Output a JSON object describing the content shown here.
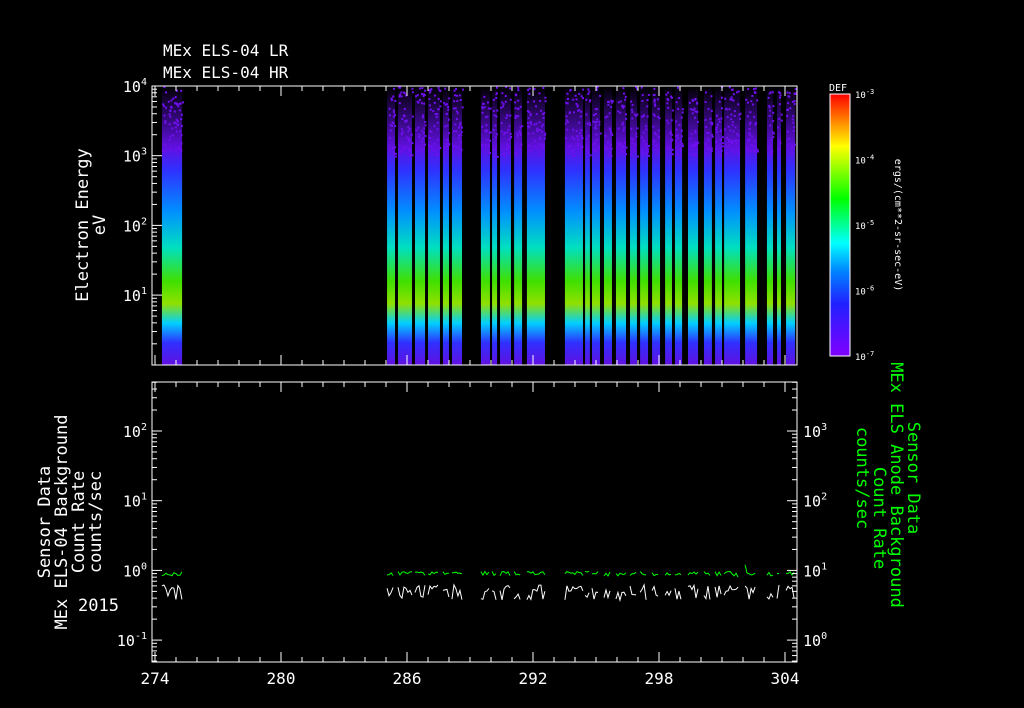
{
  "chart_data": [
    {
      "type": "heatmap",
      "title_lines": [
        "MEx ELS-04 LR",
        "MEx ELS-04 HR"
      ],
      "ylabel": [
        "Electron Energy",
        "eV"
      ],
      "ylim": [
        1,
        10000
      ],
      "yscale": "log",
      "yticks": [
        {
          "v": 10000,
          "b": "10",
          "e": "4"
        },
        {
          "v": 1000,
          "b": "10",
          "e": "3"
        },
        {
          "v": 100,
          "b": "10",
          "e": "2"
        },
        {
          "v": 10,
          "b": "10",
          "e": "1"
        }
      ],
      "xlim": [
        273.85,
        304.5
      ],
      "active_intervals_day": [
        [
          274.33,
          275.29
        ],
        [
          285.05,
          285.43
        ],
        [
          285.57,
          286.24
        ],
        [
          286.38,
          286.86
        ],
        [
          287.0,
          287.57
        ],
        [
          287.71,
          288.0
        ],
        [
          288.14,
          288.62
        ],
        [
          289.52,
          289.95
        ],
        [
          290.05,
          290.29
        ],
        [
          290.43,
          290.95
        ],
        [
          291.1,
          291.48
        ],
        [
          291.71,
          292.57
        ],
        [
          293.52,
          294.38
        ],
        [
          294.48,
          294.71
        ],
        [
          294.81,
          295.19
        ],
        [
          295.38,
          295.76
        ],
        [
          295.95,
          296.43
        ],
        [
          296.62,
          296.95
        ],
        [
          297.1,
          297.48
        ],
        [
          297.67,
          298.05
        ],
        [
          298.29,
          298.62
        ],
        [
          298.76,
          299.1
        ],
        [
          299.38,
          299.86
        ],
        [
          300.14,
          300.52
        ],
        [
          300.67,
          301.0
        ],
        [
          301.1,
          301.86
        ],
        [
          302.1,
          302.67
        ],
        [
          303.14,
          303.43
        ],
        [
          303.62,
          303.81
        ],
        [
          304.05,
          304.48
        ]
      ],
      "colorbar": {
        "label": "DEF",
        "units": "ergs/(cm**2-sr-sec-eV)",
        "range": [
          1e-07,
          0.001
        ],
        "ticks": [
          {
            "b": "10",
            "e": "-3"
          },
          {
            "b": "10",
            "e": "-4"
          },
          {
            "b": "10",
            "e": "-5"
          },
          {
            "b": "10",
            "e": "-6"
          },
          {
            "b": "10",
            "e": "-7"
          }
        ]
      }
    },
    {
      "type": "line",
      "ylabel_left": [
        "Sensor Data",
        "MEx ELS-04 Background",
        "Count Rate",
        "counts/sec"
      ],
      "ylabel_right": [
        "Sensor Data",
        "MEx ELS Anode Background",
        "Count Rate",
        "counts/sec"
      ],
      "ylim_left": [
        0.05,
        500
      ],
      "ylim_right": [
        0.5,
        5000
      ],
      "yscale": "log",
      "yticks_left": [
        {
          "b": "10",
          "e": "2"
        },
        {
          "b": "10",
          "e": "1"
        },
        {
          "b": "10",
          "e": "0"
        },
        {
          "b": "10",
          "e": "-1"
        }
      ],
      "yticks_right": [
        {
          "b": "10",
          "e": "3"
        },
        {
          "b": "10",
          "e": "2"
        },
        {
          "b": "10",
          "e": "1"
        },
        {
          "b": "10",
          "e": "0"
        }
      ],
      "xlabel_year": "2015",
      "xticks": [
        "274",
        "280",
        "286",
        "292",
        "298",
        "304"
      ],
      "xtick_values": [
        274,
        280,
        286,
        292,
        298,
        304
      ],
      "series": [
        {
          "name": "ELS-04 Background (left axis)",
          "color": "#ffffff",
          "typical_value": 0.5
        },
        {
          "name": "ELS Anode Background (right axis)",
          "color": "#00ff00",
          "typical_value": 9,
          "peak": {
            "day": 302.0,
            "value": 15
          }
        }
      ]
    }
  ]
}
